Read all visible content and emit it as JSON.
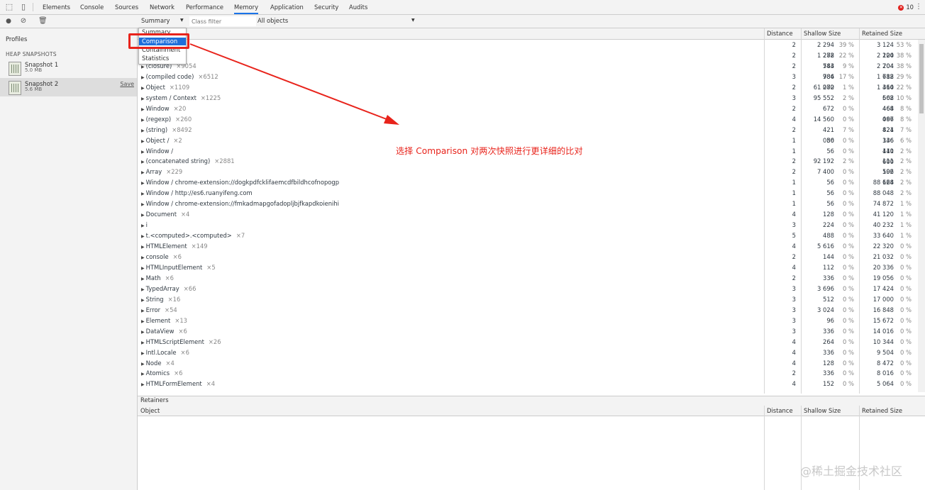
{
  "tabs": [
    "Elements",
    "Console",
    "Sources",
    "Network",
    "Performance",
    "Memory",
    "Application",
    "Security",
    "Audits"
  ],
  "active_tab": "Memory",
  "error_count": "10",
  "toolbar": {
    "view_select": "Summary",
    "class_filter_placeholder": "Class filter",
    "objects_select": "All objects"
  },
  "sidebar": {
    "title": "Profiles",
    "section": "HEAP SNAPSHOTS",
    "snapshots": [
      {
        "name": "Snapshot 1",
        "size": "5.0 MB"
      },
      {
        "name": "Snapshot 2",
        "size": "5.6 MB",
        "save": "Save"
      }
    ]
  },
  "dropdown": {
    "items": [
      "Summary",
      "Comparison",
      "Containment",
      "Statistics"
    ],
    "selected": "Comparison"
  },
  "columns": {
    "distance": "Distance",
    "shallow": "Shallow Size",
    "retained": "Retained Size"
  },
  "rows": [
    {
      "name": "",
      "count": "",
      "distance": "2",
      "shallow": "2 294 272",
      "shallow_pct": "39 %",
      "retained": "3 124 104",
      "retained_pct": "53 %"
    },
    {
      "name": "",
      "count": "",
      "distance": "2",
      "shallow": "1 288 784",
      "shallow_pct": "22 %",
      "retained": "2 220 704",
      "retained_pct": "38 %"
    },
    {
      "name": "(closure)",
      "count": "×9054",
      "distance": "2",
      "shallow": "543 784",
      "shallow_pct": "9 %",
      "retained": "2 204 688",
      "retained_pct": "38 %"
    },
    {
      "name": "(compiled code)",
      "count": "×6512",
      "distance": "3",
      "shallow": "986 080",
      "shallow_pct": "17 %",
      "retained": "1 712 464",
      "retained_pct": "29 %"
    },
    {
      "name": "Object",
      "count": "×1109",
      "distance": "2",
      "shallow": "61 272",
      "shallow_pct": "1 %",
      "retained": "1 310 608",
      "retained_pct": "22 %"
    },
    {
      "name": "system / Context",
      "count": "×1225",
      "distance": "3",
      "shallow": "95 552",
      "shallow_pct": "2 %",
      "retained": "562 464",
      "retained_pct": "10 %"
    },
    {
      "name": "Window",
      "count": "×20",
      "distance": "2",
      "shallow": "672",
      "shallow_pct": "0 %",
      "retained": "468 096",
      "retained_pct": "8 %"
    },
    {
      "name": "(regexp)",
      "count": "×260",
      "distance": "4",
      "shallow": "14 560",
      "shallow_pct": "0 %",
      "retained": "467 824",
      "retained_pct": "8 %"
    },
    {
      "name": "(string)",
      "count": "×8492",
      "distance": "2",
      "shallow": "421 056",
      "shallow_pct": "7 %",
      "retained": "421 136",
      "retained_pct": "7 %"
    },
    {
      "name": "Object /",
      "count": "×2",
      "distance": "1",
      "shallow": "80",
      "shallow_pct": "0 %",
      "retained": "346 440",
      "retained_pct": "6 %"
    },
    {
      "name": "Window /",
      "count": "",
      "distance": "1",
      "shallow": "56",
      "shallow_pct": "0 %",
      "retained": "111 600",
      "retained_pct": "2 %"
    },
    {
      "name": "(concatenated string)",
      "count": "×2881",
      "distance": "2",
      "shallow": "92 192",
      "shallow_pct": "2 %",
      "retained": "111 592",
      "retained_pct": "2 %"
    },
    {
      "name": "Array",
      "count": "×229",
      "distance": "2",
      "shallow": "7 400",
      "shallow_pct": "0 %",
      "retained": "106 128",
      "retained_pct": "2 %"
    },
    {
      "name": "Window / chrome-extension://dogkpdfcklifaemcdfbildhcofnopogp",
      "count": "",
      "distance": "1",
      "shallow": "56",
      "shallow_pct": "0 %",
      "retained": "88 664",
      "retained_pct": "2 %"
    },
    {
      "name": "Window / http://es6.ruanyifeng.com",
      "count": "",
      "distance": "1",
      "shallow": "56",
      "shallow_pct": "0 %",
      "retained": "88 048",
      "retained_pct": "2 %"
    },
    {
      "name": "Window / chrome-extension://fmkadmapgofadopljbjfkapdkoienihi",
      "count": "",
      "distance": "1",
      "shallow": "56",
      "shallow_pct": "0 %",
      "retained": "74 872",
      "retained_pct": "1 %"
    },
    {
      "name": "Document",
      "count": "×4",
      "distance": "4",
      "shallow": "128",
      "shallow_pct": "0 %",
      "retained": "41 120",
      "retained_pct": "1 %"
    },
    {
      "name": "i",
      "count": "",
      "distance": "3",
      "shallow": "224",
      "shallow_pct": "0 %",
      "retained": "40 232",
      "retained_pct": "1 %"
    },
    {
      "name": "t.<computed>.<computed>",
      "count": "×7",
      "distance": "5",
      "shallow": "488",
      "shallow_pct": "0 %",
      "retained": "33 640",
      "retained_pct": "1 %"
    },
    {
      "name": "HTMLElement",
      "count": "×149",
      "distance": "4",
      "shallow": "5 616",
      "shallow_pct": "0 %",
      "retained": "22 320",
      "retained_pct": "0 %"
    },
    {
      "name": "console",
      "count": "×6",
      "distance": "2",
      "shallow": "144",
      "shallow_pct": "0 %",
      "retained": "21 032",
      "retained_pct": "0 %"
    },
    {
      "name": "HTMLInputElement",
      "count": "×5",
      "distance": "4",
      "shallow": "112",
      "shallow_pct": "0 %",
      "retained": "20 336",
      "retained_pct": "0 %"
    },
    {
      "name": "Math",
      "count": "×6",
      "distance": "2",
      "shallow": "336",
      "shallow_pct": "0 %",
      "retained": "19 056",
      "retained_pct": "0 %"
    },
    {
      "name": "TypedArray",
      "count": "×66",
      "distance": "3",
      "shallow": "3 696",
      "shallow_pct": "0 %",
      "retained": "17 424",
      "retained_pct": "0 %"
    },
    {
      "name": "String",
      "count": "×16",
      "distance": "3",
      "shallow": "512",
      "shallow_pct": "0 %",
      "retained": "17 000",
      "retained_pct": "0 %"
    },
    {
      "name": "Error",
      "count": "×54",
      "distance": "3",
      "shallow": "3 024",
      "shallow_pct": "0 %",
      "retained": "16 848",
      "retained_pct": "0 %"
    },
    {
      "name": "Element",
      "count": "×13",
      "distance": "3",
      "shallow": "96",
      "shallow_pct": "0 %",
      "retained": "15 672",
      "retained_pct": "0 %"
    },
    {
      "name": "DataView",
      "count": "×6",
      "distance": "3",
      "shallow": "336",
      "shallow_pct": "0 %",
      "retained": "14 016",
      "retained_pct": "0 %"
    },
    {
      "name": "HTMLScriptElement",
      "count": "×26",
      "distance": "4",
      "shallow": "264",
      "shallow_pct": "0 %",
      "retained": "10 344",
      "retained_pct": "0 %"
    },
    {
      "name": "Intl.Locale",
      "count": "×6",
      "distance": "4",
      "shallow": "336",
      "shallow_pct": "0 %",
      "retained": "9 504",
      "retained_pct": "0 %"
    },
    {
      "name": "Node",
      "count": "×4",
      "distance": "4",
      "shallow": "128",
      "shallow_pct": "0 %",
      "retained": "8 472",
      "retained_pct": "0 %"
    },
    {
      "name": "Atomics",
      "count": "×6",
      "distance": "2",
      "shallow": "336",
      "shallow_pct": "0 %",
      "retained": "8 016",
      "retained_pct": "0 %"
    },
    {
      "name": "HTMLFormElement",
      "count": "×4",
      "distance": "4",
      "shallow": "152",
      "shallow_pct": "0 %",
      "retained": "5 064",
      "retained_pct": "0 %"
    }
  ],
  "annotation": "选择 Comparison 对两次快照进行更详细的比对",
  "retainers": {
    "title": "Retainers",
    "object": "Object",
    "distance": "Distance",
    "shallow": "Shallow Size",
    "retained": "Retained Size"
  },
  "watermark": "@稀土掘金技术社区"
}
